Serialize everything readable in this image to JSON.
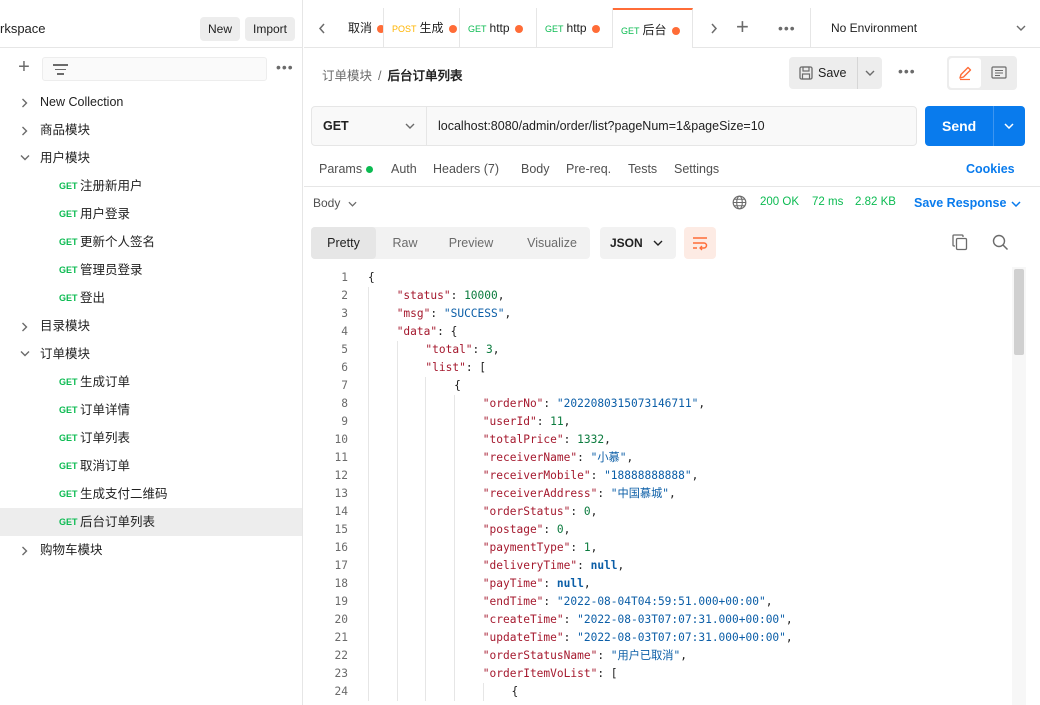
{
  "sidebar": {
    "workspace_title": "rkspace",
    "new_label": "New",
    "import_label": "Import",
    "tree": [
      {
        "type": "collection",
        "expanded": false,
        "label": "New Collection"
      },
      {
        "type": "collection",
        "expanded": false,
        "label": "商品模块"
      },
      {
        "type": "collection",
        "expanded": true,
        "label": "用户模块"
      },
      {
        "type": "request",
        "method": "GET",
        "label": "注册新用户"
      },
      {
        "type": "request",
        "method": "GET",
        "label": "用户登录"
      },
      {
        "type": "request",
        "method": "GET",
        "label": "更新个人签名"
      },
      {
        "type": "request",
        "method": "GET",
        "label": "管理员登录"
      },
      {
        "type": "request",
        "method": "GET",
        "label": "登出"
      },
      {
        "type": "collection",
        "expanded": false,
        "label": "目录模块"
      },
      {
        "type": "collection",
        "expanded": true,
        "label": "订单模块"
      },
      {
        "type": "request",
        "method": "GET",
        "label": "生成订单"
      },
      {
        "type": "request",
        "method": "GET",
        "label": "订单详情"
      },
      {
        "type": "request",
        "method": "GET",
        "label": "订单列表"
      },
      {
        "type": "request",
        "method": "GET",
        "label": "取消订单"
      },
      {
        "type": "request",
        "method": "GET",
        "label": "生成支付二维码"
      },
      {
        "type": "request",
        "method": "GET",
        "label": "后台订单列表",
        "selected": true
      },
      {
        "type": "collection",
        "expanded": false,
        "label": "购物车模块"
      }
    ]
  },
  "tabs": {
    "items": [
      {
        "method": "",
        "label": "取消"
      },
      {
        "method": "POST",
        "label": "生成"
      },
      {
        "method": "GET",
        "label": "http"
      },
      {
        "method": "GET",
        "label": "http"
      },
      {
        "method": "GET",
        "label": "后台",
        "active": true
      }
    ],
    "environment": "No Environment"
  },
  "request": {
    "breadcrumb_parent": "订单模块",
    "breadcrumb_sep": "/",
    "breadcrumb_current": "后台订单列表",
    "save_label": "Save",
    "method": "GET",
    "url": "localhost:8080/admin/order/list?pageNum=1&pageSize=10",
    "send_label": "Send",
    "tabs": [
      "Params",
      "Auth",
      "Headers (7)",
      "Body",
      "Pre-req.",
      "Tests",
      "Settings"
    ],
    "cookies_label": "Cookies"
  },
  "response": {
    "body_label": "Body",
    "status": "200 OK",
    "time": "72 ms",
    "size": "2.82 KB",
    "save_response_label": "Save Response",
    "view_tabs": [
      "Pretty",
      "Raw",
      "Preview",
      "Visualize"
    ],
    "format": "JSON",
    "lines": [
      {
        "n": "1",
        "indent": 0,
        "segs": [
          [
            "p",
            "{"
          ]
        ]
      },
      {
        "n": "2",
        "indent": 1,
        "segs": [
          [
            "k",
            "\"status\""
          ],
          [
            "p",
            ": "
          ],
          [
            "n",
            "10000"
          ],
          [
            "p",
            ","
          ]
        ]
      },
      {
        "n": "3",
        "indent": 1,
        "segs": [
          [
            "k",
            "\"msg\""
          ],
          [
            "p",
            ": "
          ],
          [
            "s",
            "\"SUCCESS\""
          ],
          [
            "p",
            ","
          ]
        ]
      },
      {
        "n": "4",
        "indent": 1,
        "segs": [
          [
            "k",
            "\"data\""
          ],
          [
            "p",
            ": {"
          ]
        ]
      },
      {
        "n": "5",
        "indent": 2,
        "segs": [
          [
            "k",
            "\"total\""
          ],
          [
            "p",
            ": "
          ],
          [
            "n",
            "3"
          ],
          [
            "p",
            ","
          ]
        ]
      },
      {
        "n": "6",
        "indent": 2,
        "segs": [
          [
            "k",
            "\"list\""
          ],
          [
            "p",
            ": ["
          ]
        ]
      },
      {
        "n": "7",
        "indent": 3,
        "segs": [
          [
            "p",
            "{"
          ]
        ]
      },
      {
        "n": "8",
        "indent": 4,
        "segs": [
          [
            "k",
            "\"orderNo\""
          ],
          [
            "p",
            ": "
          ],
          [
            "s",
            "\"2022080315073146711\""
          ],
          [
            "p",
            ","
          ]
        ]
      },
      {
        "n": "9",
        "indent": 4,
        "segs": [
          [
            "k",
            "\"userId\""
          ],
          [
            "p",
            ": "
          ],
          [
            "n",
            "11"
          ],
          [
            "p",
            ","
          ]
        ]
      },
      {
        "n": "10",
        "indent": 4,
        "segs": [
          [
            "k",
            "\"totalPrice\""
          ],
          [
            "p",
            ": "
          ],
          [
            "n",
            "1332"
          ],
          [
            "p",
            ","
          ]
        ]
      },
      {
        "n": "11",
        "indent": 4,
        "segs": [
          [
            "k",
            "\"receiverName\""
          ],
          [
            "p",
            ": "
          ],
          [
            "s",
            "\"小慕\""
          ],
          [
            "p",
            ","
          ]
        ]
      },
      {
        "n": "12",
        "indent": 4,
        "segs": [
          [
            "k",
            "\"receiverMobile\""
          ],
          [
            "p",
            ": "
          ],
          [
            "s",
            "\"18888888888\""
          ],
          [
            "p",
            ","
          ]
        ]
      },
      {
        "n": "13",
        "indent": 4,
        "segs": [
          [
            "k",
            "\"receiverAddress\""
          ],
          [
            "p",
            ": "
          ],
          [
            "s",
            "\"中国慕城\""
          ],
          [
            "p",
            ","
          ]
        ]
      },
      {
        "n": "14",
        "indent": 4,
        "segs": [
          [
            "k",
            "\"orderStatus\""
          ],
          [
            "p",
            ": "
          ],
          [
            "n",
            "0"
          ],
          [
            "p",
            ","
          ]
        ]
      },
      {
        "n": "15",
        "indent": 4,
        "segs": [
          [
            "k",
            "\"postage\""
          ],
          [
            "p",
            ": "
          ],
          [
            "n",
            "0"
          ],
          [
            "p",
            ","
          ]
        ]
      },
      {
        "n": "16",
        "indent": 4,
        "segs": [
          [
            "k",
            "\"paymentType\""
          ],
          [
            "p",
            ": "
          ],
          [
            "n",
            "1"
          ],
          [
            "p",
            ","
          ]
        ]
      },
      {
        "n": "17",
        "indent": 4,
        "segs": [
          [
            "k",
            "\"deliveryTime\""
          ],
          [
            "p",
            ": "
          ],
          [
            "b",
            "null"
          ],
          [
            "p",
            ","
          ]
        ]
      },
      {
        "n": "18",
        "indent": 4,
        "segs": [
          [
            "k",
            "\"payTime\""
          ],
          [
            "p",
            ": "
          ],
          [
            "b",
            "null"
          ],
          [
            "p",
            ","
          ]
        ]
      },
      {
        "n": "19",
        "indent": 4,
        "segs": [
          [
            "k",
            "\"endTime\""
          ],
          [
            "p",
            ": "
          ],
          [
            "s",
            "\"2022-08-04T04:59:51.000+00:00\""
          ],
          [
            "p",
            ","
          ]
        ]
      },
      {
        "n": "20",
        "indent": 4,
        "segs": [
          [
            "k",
            "\"createTime\""
          ],
          [
            "p",
            ": "
          ],
          [
            "s",
            "\"2022-08-03T07:07:31.000+00:00\""
          ],
          [
            "p",
            ","
          ]
        ]
      },
      {
        "n": "21",
        "indent": 4,
        "segs": [
          [
            "k",
            "\"updateTime\""
          ],
          [
            "p",
            ": "
          ],
          [
            "s",
            "\"2022-08-03T07:07:31.000+00:00\""
          ],
          [
            "p",
            ","
          ]
        ]
      },
      {
        "n": "22",
        "indent": 4,
        "segs": [
          [
            "k",
            "\"orderStatusName\""
          ],
          [
            "p",
            ": "
          ],
          [
            "s",
            "\"用户已取消\""
          ],
          [
            "p",
            ","
          ]
        ]
      },
      {
        "n": "23",
        "indent": 4,
        "segs": [
          [
            "k",
            "\"orderItemVoList\""
          ],
          [
            "p",
            ": ["
          ]
        ]
      },
      {
        "n": "24",
        "indent": 5,
        "segs": [
          [
            "p",
            "{"
          ]
        ]
      }
    ]
  },
  "colors": {
    "accent": "#ff6c37",
    "primary": "#097bed",
    "get": "#0cbb52",
    "post": "#ffb400",
    "json_key": "#a5192e",
    "json_string": "#0b5ea7",
    "json_number": "#0b7b3e"
  },
  "icons": {
    "sidebar_add": "plus-icon",
    "sidebar_filter": "filter-icon",
    "save": "floppy-icon",
    "edit_mode": "pencil-icon",
    "doc_mode": "document-icon",
    "response_globe": "globe-icon",
    "wrap": "wrap-lines-icon",
    "copy": "copy-icon",
    "search": "search-icon"
  }
}
